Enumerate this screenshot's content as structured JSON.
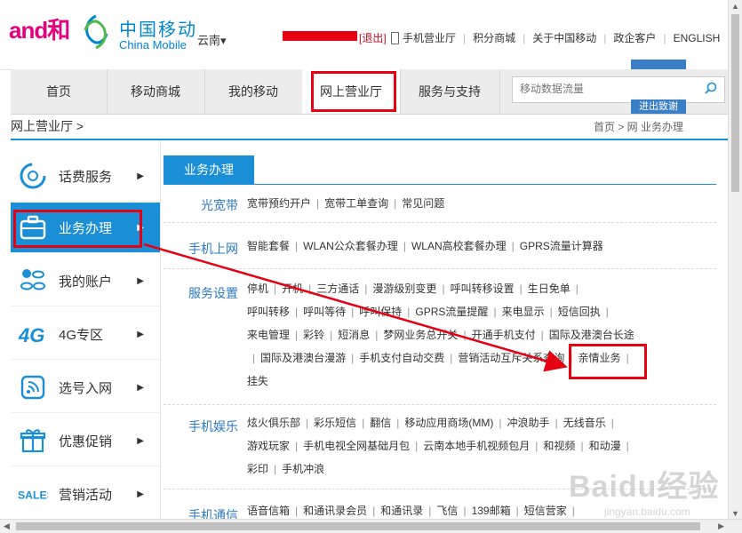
{
  "header": {
    "and_logo": "and和",
    "brand_cn": "中国移动",
    "brand_en": "China Mobile",
    "region": "云南▾",
    "logout": "[退出]",
    "links": [
      "手机营业厅",
      "积分商城",
      "关于中国移动",
      "政企客户",
      "ENGLISH"
    ]
  },
  "nav": {
    "items": [
      "首页",
      "移动商城",
      "我的移动",
      "网上营业厅",
      "服务与支持"
    ],
    "search_placeholder": "移动数据流量",
    "overlay_btn": "进出致谢"
  },
  "breadcrumb": {
    "left": "网上营业厅 >",
    "right": "首页 > 网   业务办理"
  },
  "sidebar": {
    "items": [
      "话费服务",
      "业务办理",
      "我的账户",
      "4G专区",
      "选号入网",
      "优惠促销",
      "营销活动"
    ],
    "arrow": "▶"
  },
  "main": {
    "section_title": "业务办理",
    "rows": [
      {
        "label": "光宽带",
        "links": [
          "宽带预约开户",
          "宽带工单查询",
          "常见问题"
        ]
      },
      {
        "label": "手机上网",
        "links": [
          "智能套餐",
          "WLAN公众套餐办理",
          "WLAN高校套餐办理",
          "GPRS流量计算器"
        ]
      },
      {
        "label": "服务设置",
        "links": [
          "停机",
          "开机",
          "三方通话",
          "漫游级别变更",
          "呼叫转移设置",
          "生日免单",
          "呼叫转移",
          "呼叫等待",
          "呼叫保持",
          "GPRS流量提醒",
          "来电显示",
          "短信回执",
          "来电管理",
          "彩铃",
          "短消息",
          "梦网业务总开关",
          "开通手机支付",
          "国际及港澳台长途",
          "国际及港澳台漫游",
          "手机支付自动交费",
          "营销活动互斥关系查询",
          "亲情业务",
          "挂失"
        ]
      },
      {
        "label": "手机娱乐",
        "links": [
          "炫火俱乐部",
          "彩乐短信",
          "翻信",
          "移动应用商场(MM)",
          "冲浪助手",
          "无线音乐",
          "游戏玩家",
          "手机电视全网基础月包",
          "云南本地手机视频包月",
          "和视频",
          "和动漫",
          "彩印",
          "手机冲浪"
        ]
      },
      {
        "label": "手机通信",
        "links": [
          "语音信箱",
          "和通讯录会员",
          "和通讯录",
          "飞信",
          "139邮箱",
          "短信营家"
        ]
      }
    ]
  },
  "watermark": {
    "text": "Baidu经验",
    "sub": "jingyan.baidu.com"
  },
  "colors": {
    "brand_blue": "#1a8fd8",
    "highlight_red": "#e60012",
    "label_blue": "#2d78c1"
  }
}
